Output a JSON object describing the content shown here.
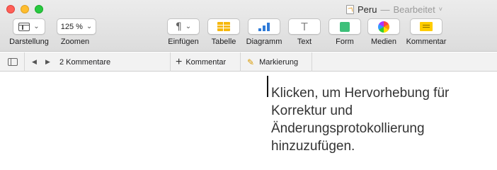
{
  "window": {
    "title": "Peru",
    "separator": "—",
    "state": "Bearbeitet",
    "chevron": "˅",
    "traffic_lights": {
      "close": "#ff5f57",
      "minimize": "#ffbd2e",
      "zoom": "#28c940"
    }
  },
  "toolbar": {
    "view": {
      "label": "Darstellung",
      "icon": "view-icon",
      "chevron": "⌄"
    },
    "zoom": {
      "label": "Zoomen",
      "value": "125 %",
      "chevron": "⌄"
    },
    "insert": {
      "label": "Einfügen",
      "icon": "paragraph-icon",
      "glyph": "¶",
      "chevron": "⌄"
    },
    "table": {
      "label": "Tabelle",
      "icon": "table-icon",
      "color": "#f6b80d"
    },
    "chart": {
      "label": "Diagramm",
      "icon": "chart-icon",
      "color": "#2f7bd8"
    },
    "text": {
      "label": "Text",
      "icon": "text-icon",
      "glyph": "T"
    },
    "shape": {
      "label": "Form",
      "icon": "shape-icon",
      "color": "#3ec07a"
    },
    "media": {
      "label": "Medien",
      "icon": "media-icon"
    },
    "comment": {
      "label": "Kommentar",
      "icon": "comment-icon",
      "color": "#ffcc00"
    }
  },
  "comments_bar": {
    "sidebar_icon": "sidebar-icon",
    "prev_glyph": "◀",
    "next_glyph": "▶",
    "count_label": "2 Kommentare",
    "add_glyph": "+",
    "add_label": "Kommentar",
    "highlight_icon": "highlighter-icon",
    "highlight_glyph": "✎",
    "highlight_label": "Markierung"
  },
  "callout": {
    "text": "Klicken, um Hervorhebung für Korrektur und Änderungsprotokollierung hinzuzufügen."
  }
}
